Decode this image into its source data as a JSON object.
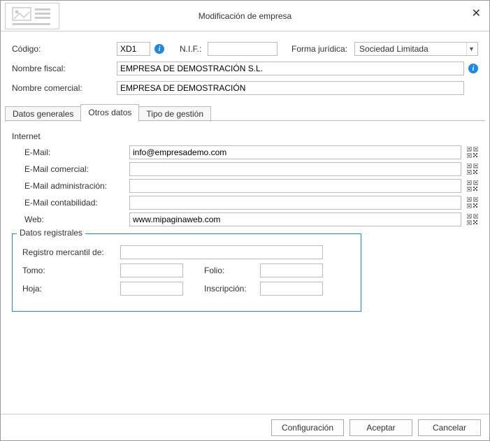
{
  "dialog": {
    "title": "Modificación de empresa"
  },
  "header": {
    "codigo_label": "Código:",
    "codigo_value": "XD1",
    "nif_label": "N.I.F.:",
    "nif_value": "",
    "forma_label": "Forma jurídica:",
    "forma_value": "Sociedad Limitada",
    "nombre_fiscal_label": "Nombre fiscal:",
    "nombre_fiscal_value": "EMPRESA DE DEMOSTRACIÓN S.L.",
    "nombre_comercial_label": "Nombre comercial:",
    "nombre_comercial_value": "EMPRESA DE DEMOSTRACIÓN"
  },
  "tabs": {
    "t0": "Datos generales",
    "t1": "Otros datos",
    "t2": "Tipo de gestión",
    "active": 1
  },
  "internet": {
    "group": "Internet",
    "email_label": "E-Mail:",
    "email_value": "info@empresademo.com",
    "email_com_label": "E-Mail comercial:",
    "email_com_value": "",
    "email_admin_label": "E-Mail administración:",
    "email_admin_value": "",
    "email_cont_label": "E-Mail contabilidad:",
    "email_cont_value": "",
    "web_label": "Web:",
    "web_value": "www.mipaginaweb.com"
  },
  "registral": {
    "legend": "Datos registrales",
    "reg_merc_label": "Registro mercantil de:",
    "reg_merc_value": "",
    "tomo_label": "Tomo:",
    "tomo_value": "",
    "folio_label": "Folio:",
    "folio_value": "",
    "hoja_label": "Hoja:",
    "hoja_value": "",
    "inscripcion_label": "Inscripción:",
    "inscripcion_value": ""
  },
  "footer": {
    "config": "Configuración",
    "ok": "Aceptar",
    "cancel": "Cancelar"
  }
}
